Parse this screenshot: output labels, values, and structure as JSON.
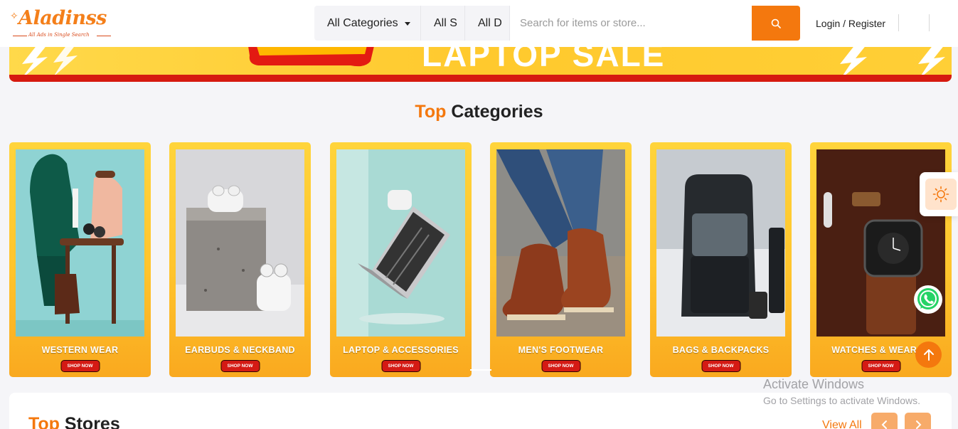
{
  "header": {
    "logo_text": "Aladinss",
    "logo_tagline": "All Ads in Single Search",
    "category_select": "All Categories",
    "select_2": "All S",
    "select_3": "All D",
    "search_placeholder": "Search for items or store...",
    "login_label": "Login / Register"
  },
  "banner": {
    "text": "LAPTOP SALE"
  },
  "categories_section": {
    "title_accent": "Top",
    "title_rest": "Categories",
    "shop_label": "SHOP NOW",
    "items": [
      {
        "label": "WESTERN WEAR"
      },
      {
        "label": "EARBUDS & NECKBAND"
      },
      {
        "label": "LAPTOP & ACCESSORIES"
      },
      {
        "label": "MEN'S FOOTWEAR"
      },
      {
        "label": "BAGS & BACKPACKS"
      },
      {
        "label": "WATCHES & WEARAB"
      }
    ]
  },
  "stores_section": {
    "title_accent": "Top",
    "title_rest": "Stores",
    "view_all": "View All"
  },
  "os_overlay": {
    "line1": "Activate Windows",
    "line2": "Go to Settings to activate Windows."
  },
  "colors": {
    "accent": "#f4780e",
    "card_yellow": "#ffc42c",
    "shop_red": "#d41a14"
  },
  "icons": [
    "search-icon",
    "sun-icon",
    "whatsapp-icon",
    "arrow-up-icon",
    "chevron-left-icon",
    "chevron-right-icon",
    "dropdown-caret-icon"
  ]
}
